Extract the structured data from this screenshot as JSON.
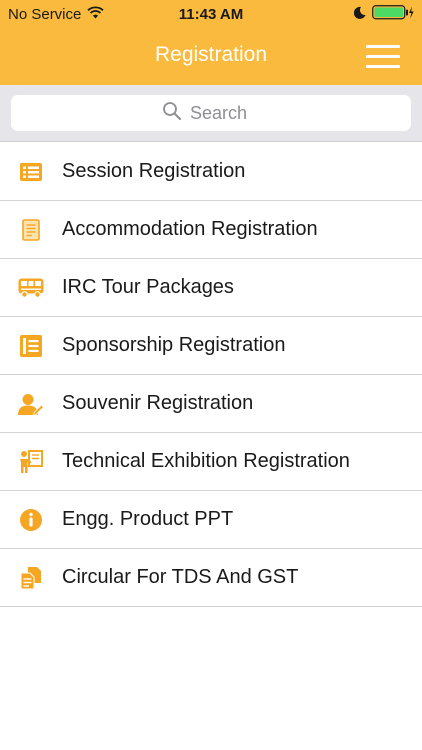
{
  "statusbar": {
    "carrier": "No Service",
    "time": "11:43 AM"
  },
  "navbar": {
    "title": "Registration"
  },
  "search": {
    "placeholder": "Search"
  },
  "colors": {
    "accent": "#f9ba3d",
    "icon": "#f5a623"
  },
  "menu": [
    {
      "label": "Session Registration",
      "icon": "list-icon"
    },
    {
      "label": "Accommodation Registration",
      "icon": "document-icon"
    },
    {
      "label": "IRC Tour Packages",
      "icon": "bus-icon"
    },
    {
      "label": "Sponsorship Registration",
      "icon": "notepad-icon"
    },
    {
      "label": "Souvenir Registration",
      "icon": "user-edit-icon"
    },
    {
      "label": "Technical Exhibition Registration",
      "icon": "presenter-icon"
    },
    {
      "label": "Engg. Product PPT",
      "icon": "info-icon"
    },
    {
      "label": "Circular For TDS And GST",
      "icon": "documents-icon"
    }
  ]
}
